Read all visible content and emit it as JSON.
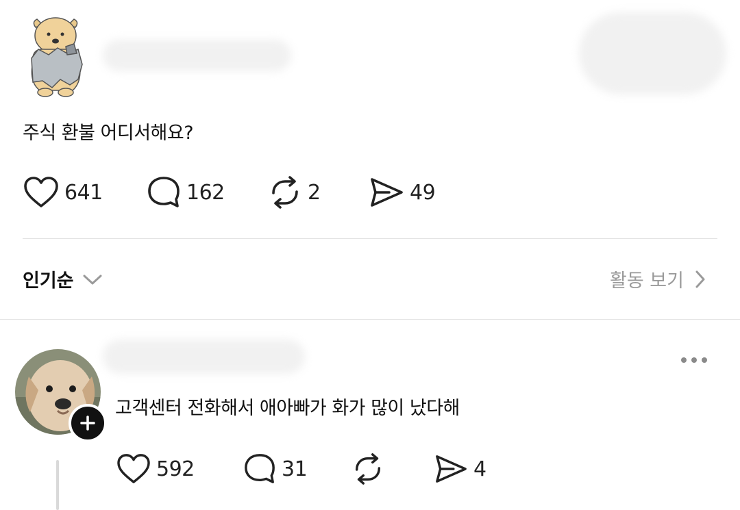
{
  "post": {
    "text": "주식 환불 어디서해요?",
    "likes": "641",
    "comments": "162",
    "reposts": "2",
    "shares": "49"
  },
  "sort": {
    "label": "인기순",
    "activity_label": "활동 보기"
  },
  "reply": {
    "text": "고객센터 전화해서 애아빠가 화가 많이 났다해",
    "likes": "592",
    "comments": "31",
    "shares": "4"
  },
  "icons": {
    "like": "heart-icon",
    "comment": "speech-bubble-icon",
    "repost": "repost-icon",
    "share": "send-icon",
    "sort": "chevron-down-icon",
    "activity": "chevron-right-icon",
    "more": "more-horizontal-icon",
    "follow": "plus-icon"
  },
  "colors": {
    "text": "#111111",
    "muted": "#9a9a9a",
    "divider": "#e3e3e3"
  }
}
